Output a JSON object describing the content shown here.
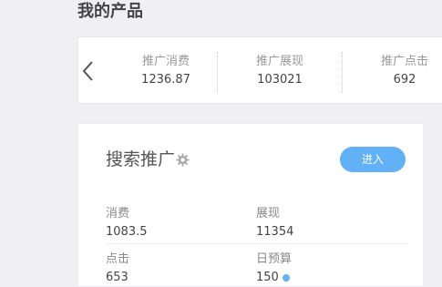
{
  "page": {
    "section_title": "我的产品"
  },
  "stats": [
    {
      "label": "推广消费",
      "value": "1236.87"
    },
    {
      "label": "推广展现",
      "value": "103021"
    },
    {
      "label": "推广点击",
      "value": "692"
    }
  ],
  "search_card": {
    "title": "搜索推广",
    "enter_label": "进入",
    "metrics": [
      {
        "label": "消费",
        "value": "1083.5"
      },
      {
        "label": "展现",
        "value": "11354"
      },
      {
        "label": "点击",
        "value": "653"
      },
      {
        "label": "日预算",
        "value": "150"
      }
    ]
  },
  "colors": {
    "accent": "#62b0f5",
    "background": "#f0f0f2",
    "card": "#ffffff"
  },
  "icons": {
    "prev": "chevron-left-icon",
    "settings": "gear-icon",
    "info": "info-icon"
  }
}
